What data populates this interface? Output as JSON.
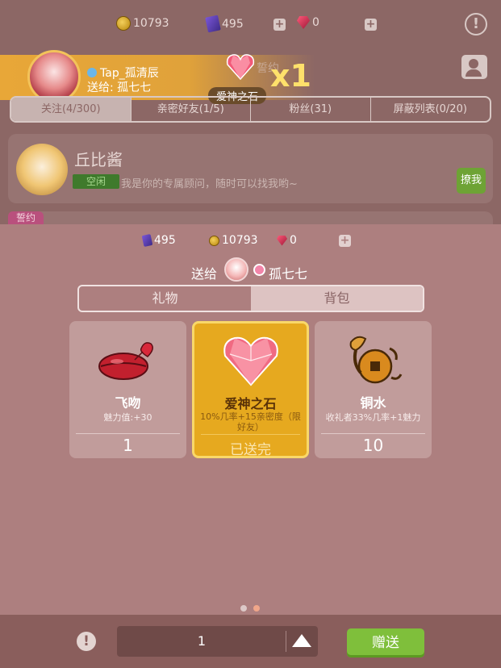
{
  "background": {
    "resources": [
      {
        "icon": "coin-icon",
        "value": "10793"
      },
      {
        "icon": "book-icon",
        "value": "495"
      },
      {
        "icon": "gem-icon",
        "value": "0"
      }
    ],
    "banner": {
      "username": "Tap_孤清辰",
      "send_to": "送给: 孤七七",
      "gift_name": "爱神之石",
      "multiplier": "x1",
      "faded_text": "誓约"
    },
    "tabs": [
      "关注(4/300)",
      "亲密好友(1/5)",
      "粉丝(31)",
      "屏蔽列表(0/20)"
    ],
    "friend": {
      "name": "丘比酱",
      "status": "空闲",
      "description": "我是你的专属顾问，随时可以找我哟~",
      "action": "撩我"
    },
    "pledge_tag": "誓约"
  },
  "panel": {
    "resources": [
      {
        "icon": "book-icon",
        "value": "495"
      },
      {
        "icon": "coin-icon",
        "value": "10793"
      },
      {
        "icon": "gem-icon",
        "value": "0"
      }
    ],
    "send_to_label": "送给",
    "recipient": "孤七七",
    "tabs": [
      "礼物",
      "背包"
    ],
    "gifts": [
      {
        "name": "飞吻",
        "desc": "魅力值:+30",
        "count": "1",
        "icon": "kiss-icon"
      },
      {
        "name": "爱神之石",
        "desc": "10%几率+15亲密度（限好友）",
        "count": "已送完",
        "icon": "heart-gem-icon"
      },
      {
        "name": "铜水",
        "desc": "收礼者33%几率+1魅力",
        "count": "10",
        "icon": "copper-dragon-icon"
      }
    ]
  },
  "bottom": {
    "quantity": "1",
    "send_label": "赠送"
  },
  "colors": {
    "panel_bg": "#ad7f7f",
    "selected_card": "#e6a91f",
    "send_button": "#7fbf3b"
  }
}
